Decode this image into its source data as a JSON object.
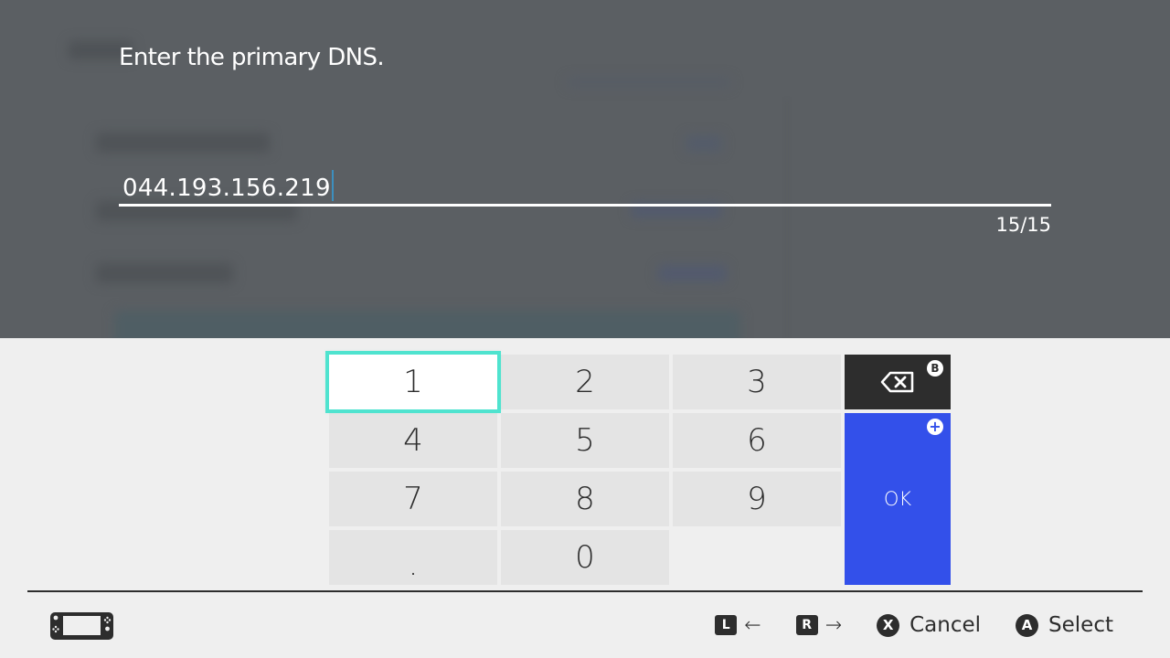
{
  "dialog": {
    "prompt": "Enter the primary DNS.",
    "input_value": "044.193.156.219",
    "char_counter": "15/15"
  },
  "keypad": {
    "keys": [
      "1",
      "2",
      "3",
      "4",
      "5",
      "6",
      "7",
      "8",
      "9",
      ".",
      "0"
    ],
    "selected_key": "1",
    "backspace_badge": "B",
    "ok_label": "OK",
    "ok_badge": "+"
  },
  "footer": {
    "console_icon": "handheld-console-icon",
    "hints": [
      {
        "button": "L",
        "label": "←"
      },
      {
        "button": "R",
        "label": "→"
      },
      {
        "button": "X",
        "label": "Cancel"
      },
      {
        "button": "A",
        "label": "Select"
      }
    ]
  },
  "colors": {
    "overlay": "#5b5f63",
    "panel": "#efefef",
    "key": "#e4e4e4",
    "focus": "#4fe3cf",
    "ok": "#3350ea",
    "dark": "#2d2d2d"
  }
}
